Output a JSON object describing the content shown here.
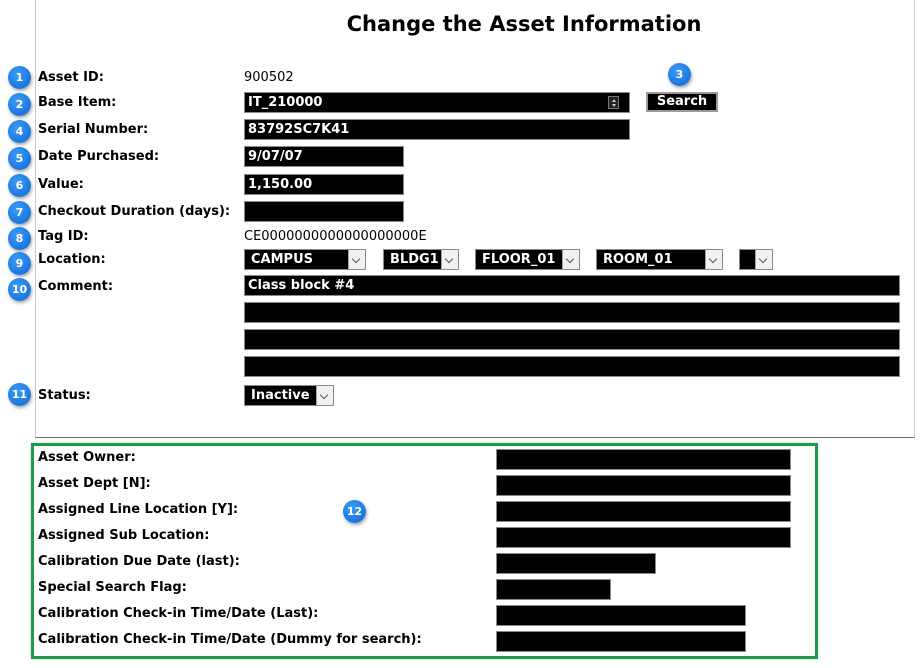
{
  "page": {
    "title": "Change the Asset Information"
  },
  "labels": {
    "asset_id": "Asset ID:",
    "base_item": "Base Item:",
    "serial_number": "Serial Number:",
    "date_purchased": "Date Purchased:",
    "value": "Value:",
    "checkout_duration": "Checkout Duration (days):",
    "tag_id": "Tag ID:",
    "location": "Location:",
    "comment": "Comment:",
    "status": "Status:"
  },
  "values": {
    "asset_id": "900502",
    "base_item": "IT_210000",
    "serial_number": "83792SC7K41",
    "date_purchased": "9/07/07",
    "value": "1,150.00",
    "checkout_duration": "",
    "tag_id": "CE0000000000000000000E",
    "location": [
      "CAMPUS",
      "BLDG1",
      "FLOOR_01",
      "ROOM_01",
      ""
    ],
    "comment": [
      "Class block #4",
      "",
      "",
      ""
    ],
    "status": "Inactive"
  },
  "search_button": "Search",
  "custom_fields": [
    {
      "label": "Asset Owner:",
      "value": ""
    },
    {
      "label": "Asset Dept [N]:",
      "value": ""
    },
    {
      "label": "Assigned Line Location [Y]:",
      "value": ""
    },
    {
      "label": "Assigned Sub Location:",
      "value": ""
    },
    {
      "label": "Calibration Due Date (last):",
      "value": ""
    },
    {
      "label": "Special Search Flag:",
      "value": ""
    },
    {
      "label": "Calibration Check-in Time/Date (Last):",
      "value": ""
    },
    {
      "label": "Calibration Check-in Time/Date (Dummy for search):",
      "value": ""
    }
  ],
  "badges": [
    "1",
    "2",
    "3",
    "4",
    "5",
    "6",
    "7",
    "8",
    "9",
    "10",
    "11",
    "12"
  ],
  "colors": {
    "badge": "#1a7ae8",
    "highlight_border": "#1f9a4a",
    "field_bg": "#000000"
  }
}
